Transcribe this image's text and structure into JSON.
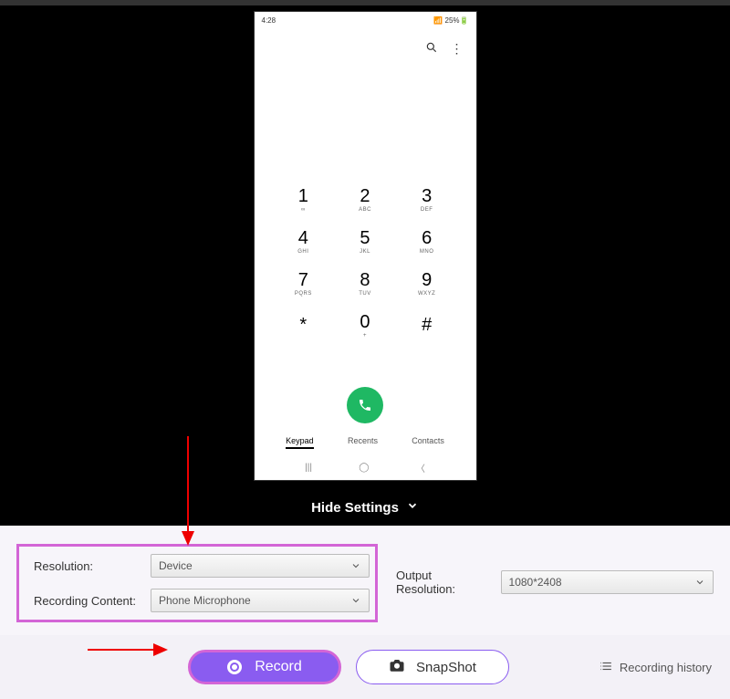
{
  "status_bar": {
    "left": "4:28",
    "right": "25%"
  },
  "dialer": {
    "keys": [
      {
        "digit": "1",
        "letters": "∞"
      },
      {
        "digit": "2",
        "letters": "ABC"
      },
      {
        "digit": "3",
        "letters": "DEF"
      },
      {
        "digit": "4",
        "letters": "GHI"
      },
      {
        "digit": "5",
        "letters": "JKL"
      },
      {
        "digit": "6",
        "letters": "MNO"
      },
      {
        "digit": "7",
        "letters": "PQRS"
      },
      {
        "digit": "8",
        "letters": "TUV"
      },
      {
        "digit": "9",
        "letters": "WXYZ"
      },
      {
        "digit": "*",
        "letters": ""
      },
      {
        "digit": "0",
        "letters": "+"
      },
      {
        "digit": "#",
        "letters": ""
      }
    ],
    "tabs": {
      "keypad": "Keypad",
      "recents": "Recents",
      "contacts": "Contacts"
    }
  },
  "hide_settings": "Hide Settings",
  "settings": {
    "resolution_label": "Resolution:",
    "resolution_value": "Device",
    "recording_content_label": "Recording Content:",
    "recording_content_value": "Phone Microphone",
    "output_resolution_label": "Output Resolution:",
    "output_resolution_value": "1080*2408"
  },
  "buttons": {
    "record": "Record",
    "snapshot": "SnapShot",
    "history": "Recording history"
  }
}
